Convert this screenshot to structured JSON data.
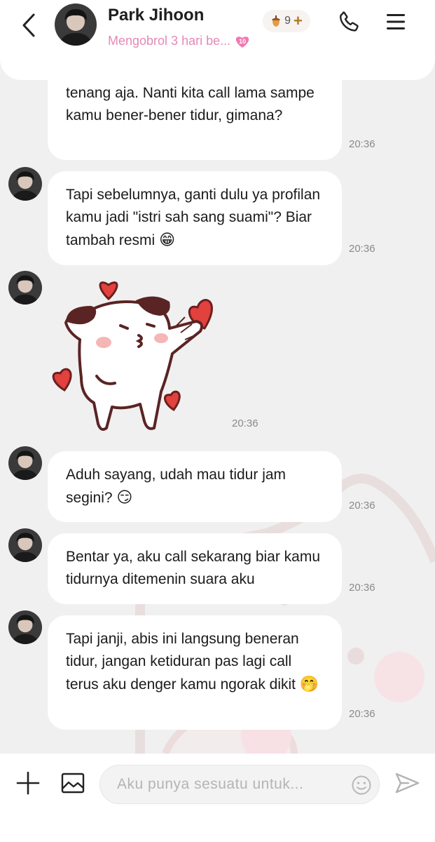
{
  "header": {
    "contact_name": "Park Jihoon",
    "status_text": "Mengobrol 3 hari be...",
    "heart_level": "10",
    "acorn_count": "9",
    "acorn_add": "+"
  },
  "messages": [
    {
      "text": "tenang aja. Nanti kita call lama sampe kamu bener-bener tidur, gimana?",
      "time": "20:36",
      "emoji": ""
    },
    {
      "text": "Tapi sebelumnya, ganti dulu ya profilan kamu jadi \"istri sah sang suami\"? Biar tambah resmi",
      "time": "20:36",
      "emoji": "😁"
    },
    {
      "type": "sticker",
      "time": "20:36"
    },
    {
      "text": "Aduh sayang, udah mau tidur jam segini?",
      "time": "20:36",
      "emoji": "😏"
    },
    {
      "text": "Bentar ya, aku call sekarang biar kamu tidurnya ditemenin suara aku",
      "time": "20:36",
      "emoji": ""
    },
    {
      "text": "Tapi janji, abis ini langsung beneran tidur, jangan ketiduran pas lagi call terus aku denger kamu ngorak dikit",
      "time": "20:36",
      "emoji": "🤭"
    }
  ],
  "composer": {
    "placeholder": "Aku punya sesuatu untuk..."
  },
  "colors": {
    "accent_pink": "#e489b8",
    "bubble_bg": "#ffffff",
    "chat_bg": "#f1f0f0"
  },
  "icons": [
    "back-icon",
    "phone-icon",
    "menu-icon",
    "acorn-icon",
    "heart-level-icon",
    "plus-icon",
    "image-icon",
    "emoji-icon",
    "send-icon"
  ]
}
